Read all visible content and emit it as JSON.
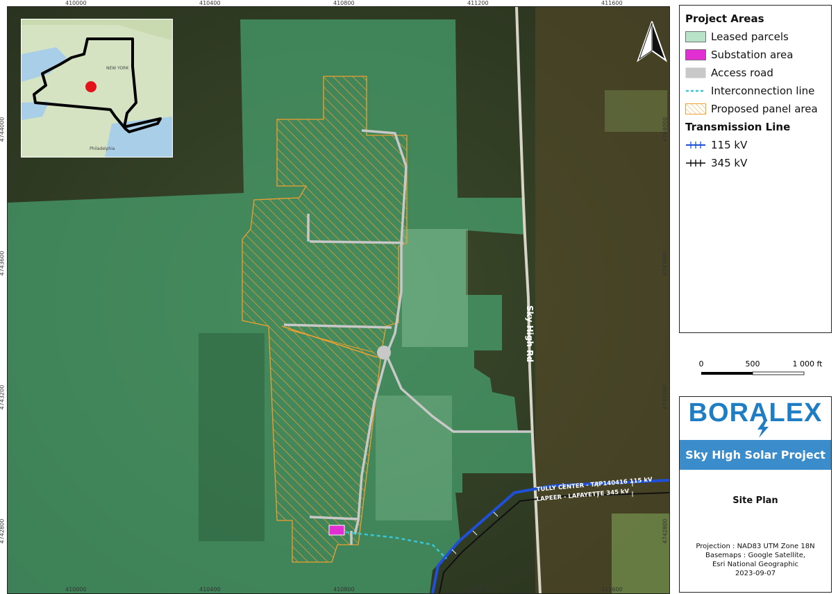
{
  "legend": {
    "project_areas_heading": "Project Areas",
    "items": [
      {
        "label": "Leased parcels",
        "color": "#8ed2a8"
      },
      {
        "label": "Substation area",
        "color": "#e12fd3"
      },
      {
        "label": "Access road",
        "color": "#c8c8c8"
      },
      {
        "label": "Interconnection line",
        "color": "#37c7d6"
      },
      {
        "label": "Proposed panel area",
        "color": "#f0a030"
      }
    ],
    "transmission_heading": "Transmission Line",
    "lines": [
      {
        "label": "115 kV",
        "color": "#1e50d8"
      },
      {
        "label": "345 kV",
        "color": "#000000"
      }
    ]
  },
  "scale": {
    "labels": [
      "0",
      "500",
      "1 000 ft"
    ]
  },
  "title_block": {
    "logo": "BORALEX",
    "project_name": "Sky High Solar Project",
    "map_title": "Site Plan",
    "projection": "Projection : NAD83 UTM Zone 18N",
    "basemaps_1": "Basemaps : Google Satellite,",
    "basemaps_2": "Esri National Geographic",
    "date": "2023-09-07"
  },
  "map": {
    "road_label": "Sky High Rd",
    "line_115_label": "TULLY CENTER - TAP140416 115 kV",
    "line_345_label": "LAPEER - LAFAYETTE 345 kV",
    "inset_label_1": "NEW YORK",
    "inset_label_2": "Philadelphia",
    "easting_ticks": [
      "410000",
      "410400",
      "410800",
      "411200",
      "411600"
    ],
    "northing_ticks": [
      "4744000",
      "4743600",
      "4743200",
      "4742800"
    ]
  }
}
